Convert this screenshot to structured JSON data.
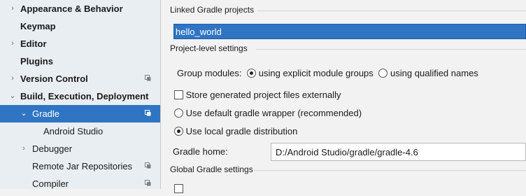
{
  "sidebar": {
    "items": [
      {
        "label": "Appearance & Behavior",
        "arrow": "›",
        "bold": true
      },
      {
        "label": "Keymap",
        "arrow": "",
        "bold": true
      },
      {
        "label": "Editor",
        "arrow": "›",
        "bold": true
      },
      {
        "label": "Plugins",
        "arrow": "",
        "bold": true
      },
      {
        "label": "Version Control",
        "arrow": "›",
        "bold": true,
        "project_icon": true
      },
      {
        "label": "Build, Execution, Deployment",
        "arrow": "⌄",
        "bold": true
      },
      {
        "label": "Gradle",
        "arrow": "⌄",
        "bold": false,
        "project_icon": true,
        "selected": true
      },
      {
        "label": "Android Studio",
        "arrow": "",
        "bold": false
      },
      {
        "label": "Debugger",
        "arrow": "›",
        "bold": false
      },
      {
        "label": "Remote Jar Repositories",
        "arrow": "",
        "bold": false,
        "project_icon": true
      },
      {
        "label": "Compiler",
        "arrow": "",
        "bold": false,
        "project_icon": true
      }
    ]
  },
  "main": {
    "linked_projects_title": "Linked Gradle projects",
    "linked_projects": [
      "hello_world"
    ],
    "project_level_title": "Project-level settings",
    "group_modules_label": "Group modules:",
    "group_option_explicit": "using explicit module groups",
    "group_option_qualified": "using qualified names",
    "store_externally_label": "Store generated project files externally",
    "use_default_wrapper_label": "Use default gradle wrapper (recommended)",
    "use_local_distribution_label": "Use local gradle distribution",
    "gradle_home_label": "Gradle home:",
    "gradle_home_value": "D:/Android Studio/gradle/gradle-4.6",
    "global_title": "Global Gradle settings"
  },
  "colors": {
    "selection": "#2f75c3",
    "sidebar_bg": "#e9eef3",
    "panel_bg": "#f2f2f2"
  }
}
